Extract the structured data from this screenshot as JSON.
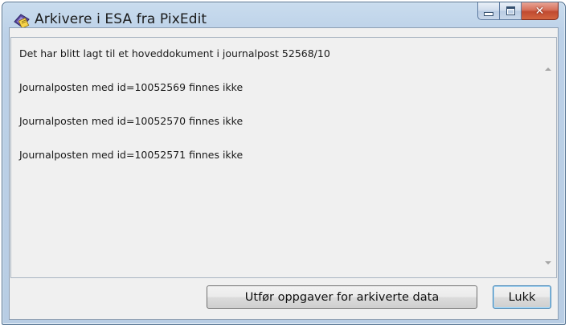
{
  "window": {
    "title": "Arkivere i ESA fra PixEdit",
    "icon": "pixedit-app-icon",
    "caption_buttons": {
      "minimize": "minimize-icon",
      "maximize": "maximize-icon",
      "close": "close-icon"
    }
  },
  "messages": [
    "Det har blitt lagt til et hoveddokument i journalpost 52568/10",
    "Journalposten med id=10052569 finnes ikke",
    "Journalposten med id=10052570 finnes ikke",
    "Journalposten med id=10052571 finnes ikke"
  ],
  "buttons": {
    "archive_tasks": "Utfør oppgaver for arkiverte data",
    "close": "Lukk"
  },
  "colors": {
    "close_button": "#c9543a",
    "frame": "#bcd1e8",
    "default_button_border": "#3c7fb1"
  }
}
